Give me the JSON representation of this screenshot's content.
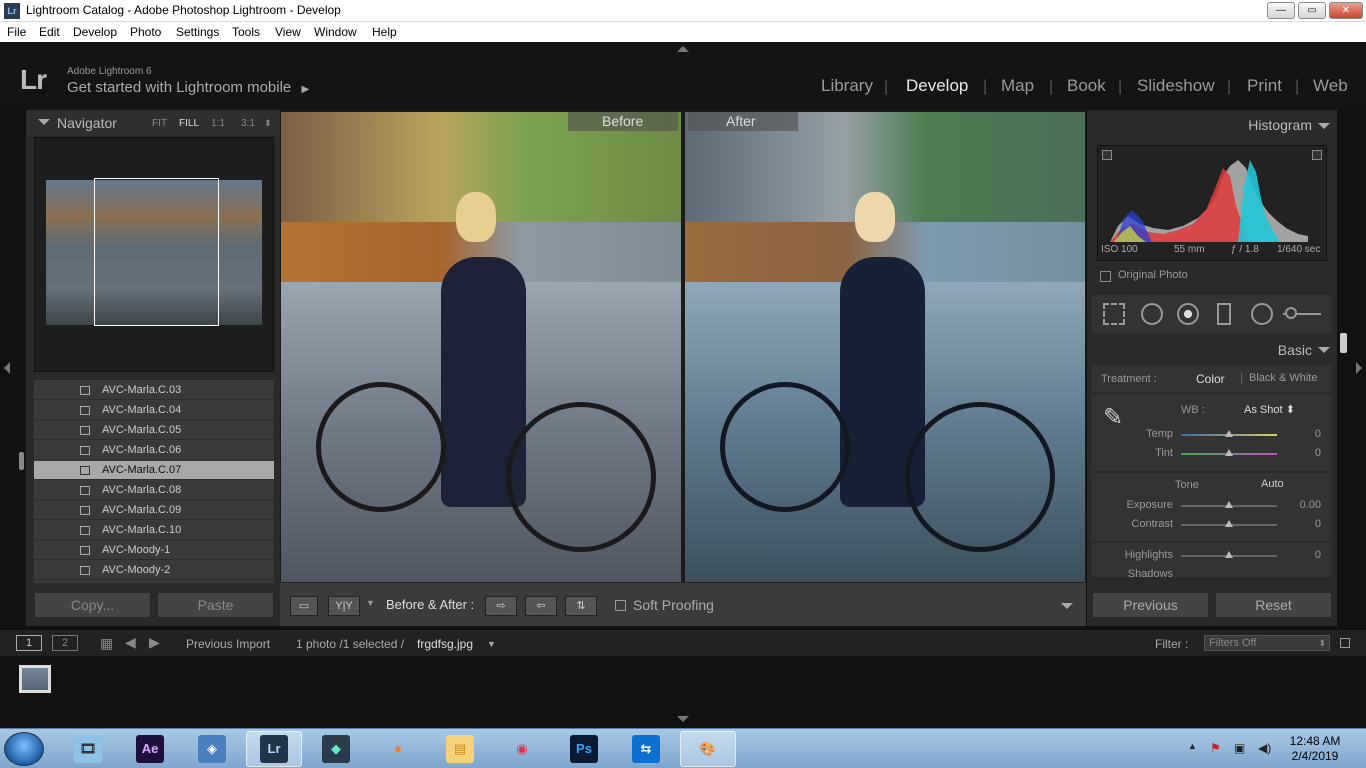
{
  "window": {
    "title": "Lightroom Catalog - Adobe Photoshop Lightroom - Develop",
    "app_icon_text": "Lr",
    "minimize": "—",
    "maximize": "▭",
    "close": "✕"
  },
  "menu": [
    "File",
    "Edit",
    "Develop",
    "Photo",
    "Settings",
    "Tools",
    "View",
    "Window",
    "Help"
  ],
  "identity": {
    "logo": "Lr",
    "brand": "Adobe Lightroom 6",
    "mobile": "Get started with Lightroom mobile",
    "mobile_arrow": "▶"
  },
  "modules": [
    {
      "label": "Library",
      "active": false
    },
    {
      "label": "Develop",
      "active": true
    },
    {
      "label": "Map",
      "active": false
    },
    {
      "label": "Book",
      "active": false
    },
    {
      "label": "Slideshow",
      "active": false
    },
    {
      "label": "Print",
      "active": false
    },
    {
      "label": "Web",
      "active": false
    }
  ],
  "module_separator": "|",
  "navigator": {
    "title": "Navigator",
    "options": [
      "FIT",
      "FILL",
      "1:1",
      "3:1"
    ],
    "active_option": "FILL"
  },
  "presets": [
    {
      "label": "AVC-Marla.C.03",
      "selected": false
    },
    {
      "label": "AVC-Marla.C.04",
      "selected": false
    },
    {
      "label": "AVC-Marla.C.05",
      "selected": false
    },
    {
      "label": "AVC-Marla.C.06",
      "selected": false
    },
    {
      "label": "AVC-Marla.C.07",
      "selected": true
    },
    {
      "label": "AVC-Marla.C.08",
      "selected": false
    },
    {
      "label": "AVC-Marla.C.09",
      "selected": false
    },
    {
      "label": "AVC-Marla.C.10",
      "selected": false
    },
    {
      "label": "AVC-Moody-1",
      "selected": false
    },
    {
      "label": "AVC-Moody-2",
      "selected": false
    }
  ],
  "left_buttons": {
    "copy": "Copy...",
    "paste": "Paste"
  },
  "view": {
    "before_label": "Before",
    "after_label": "After",
    "yy_label": "Y|Y",
    "before_after_label": "Before & After :",
    "soft_proofing": "Soft Proofing"
  },
  "histogram": {
    "title": "Histogram",
    "iso": "ISO 100",
    "focal": "55 mm",
    "aperture": "ƒ / 1.8",
    "shutter": "1/640 sec",
    "original_photo": "Original Photo"
  },
  "basic": {
    "title": "Basic",
    "treatment_label": "Treatment :",
    "color": "Color",
    "bw": "Black & White",
    "wb_label": "WB :",
    "wb_value": "As Shot ⬍",
    "temp_label": "Temp",
    "temp_value": "0",
    "temp_level": 0.5,
    "tint_label": "Tint",
    "tint_value": "0",
    "tint_level": 0.5,
    "tone_label": "Tone",
    "auto": "Auto",
    "exposure_label": "Exposure",
    "exposure_value": "0.00",
    "exposure_level": 0.5,
    "contrast_label": "Contrast",
    "contrast_value": "0",
    "contrast_level": 0.5,
    "highlights_label": "Highlights",
    "highlights_value": "0",
    "highlights_level": 0.5,
    "shadows_label": "Shadows"
  },
  "right_buttons": {
    "previous": "Previous",
    "reset": "Reset"
  },
  "filmbar": {
    "view1": "1",
    "view2": "2",
    "source": "Previous Import",
    "count": "1 photo /1 selected /",
    "filename": "frgdfsg.jpg",
    "filter_label": "Filter :",
    "filter_value": "Filters Off"
  },
  "taskbar": {
    "apps": [
      {
        "name": "video-app-icon",
        "text": "🎞",
        "color": "#333",
        "bg": "#8ec3e8",
        "active": false
      },
      {
        "name": "after-effects-icon",
        "text": "Ae",
        "color": "#d9a7ff",
        "bg": "#1f0f3d",
        "active": false
      },
      {
        "name": "network-app-icon",
        "text": "◈",
        "color": "#fff",
        "bg": "#4b7fc0",
        "active": false
      },
      {
        "name": "lightroom-icon",
        "text": "Lr",
        "color": "#b7d6f6",
        "bg": "#223447",
        "active": true
      },
      {
        "name": "filmora-icon",
        "text": "◆",
        "color": "#5ee6c8",
        "bg": "#2c3b4a",
        "active": false
      },
      {
        "name": "firefox-icon",
        "text": "●",
        "color": "#ff7a1a",
        "bg": "transparent",
        "active": false
      },
      {
        "name": "explorer-icon",
        "text": "▤",
        "color": "#c98d1d",
        "bg": "#f5d27a",
        "active": false
      },
      {
        "name": "camera-app-icon",
        "text": "◉",
        "color": "#e0304a",
        "bg": "transparent",
        "active": false
      },
      {
        "name": "photoshop-icon",
        "text": "Ps",
        "color": "#31a8ff",
        "bg": "#0a1a33",
        "active": false
      },
      {
        "name": "teamviewer-icon",
        "text": "⇆",
        "color": "#fff",
        "bg": "#0e6fd1",
        "active": false
      },
      {
        "name": "paint-icon",
        "text": "🎨",
        "color": "#a55",
        "bg": "transparent",
        "active": true
      }
    ],
    "time": "12:48 AM",
    "date": "2/4/2019"
  }
}
